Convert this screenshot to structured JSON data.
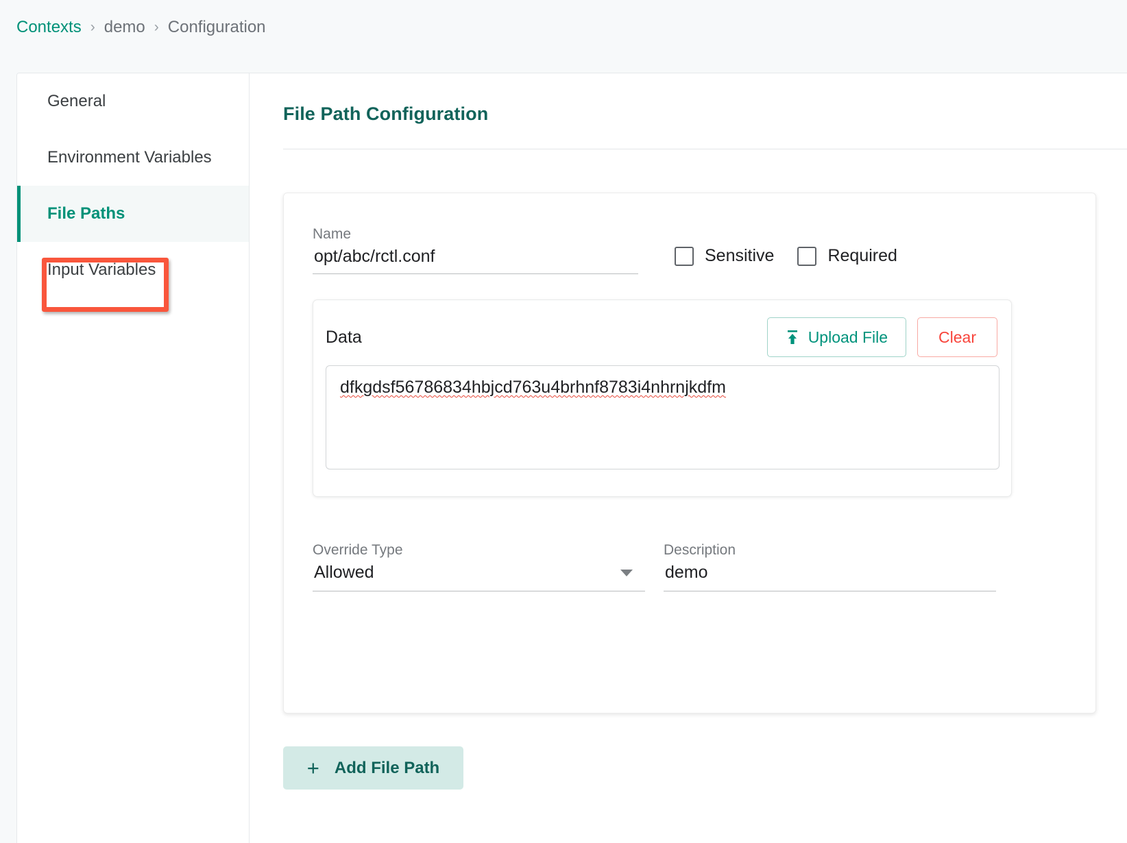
{
  "breadcrumb": {
    "root": "Contexts",
    "separator": "›",
    "context": "demo",
    "current": "Configuration"
  },
  "sidebar": {
    "items": [
      {
        "label": "General",
        "active": false
      },
      {
        "label": "Environment Variables",
        "active": false
      },
      {
        "label": "File Paths",
        "active": true
      },
      {
        "label": "Input Variables",
        "active": false
      }
    ]
  },
  "main": {
    "title": "File Path Configuration",
    "form": {
      "name_label": "Name",
      "name_value": "opt/abc/rctl.conf",
      "sensitive_label": "Sensitive",
      "sensitive_checked": false,
      "required_label": "Required",
      "required_checked": false,
      "data_label": "Data",
      "upload_button": "Upload File",
      "clear_button": "Clear",
      "data_value": "dfkgdsf56786834hbjcd763u4brhnf8783i4nhrnjkdfm",
      "override_type_label": "Override Type",
      "override_type_value": "Allowed",
      "description_label": "Description",
      "description_value": "demo"
    },
    "add_button": "Add File Path",
    "add_button_icon": "+"
  },
  "colors": {
    "accent": "#009178",
    "title": "#11635a",
    "danger": "#f8443b",
    "highlight": "#f9563c",
    "add_bg": "#d3eae6"
  }
}
